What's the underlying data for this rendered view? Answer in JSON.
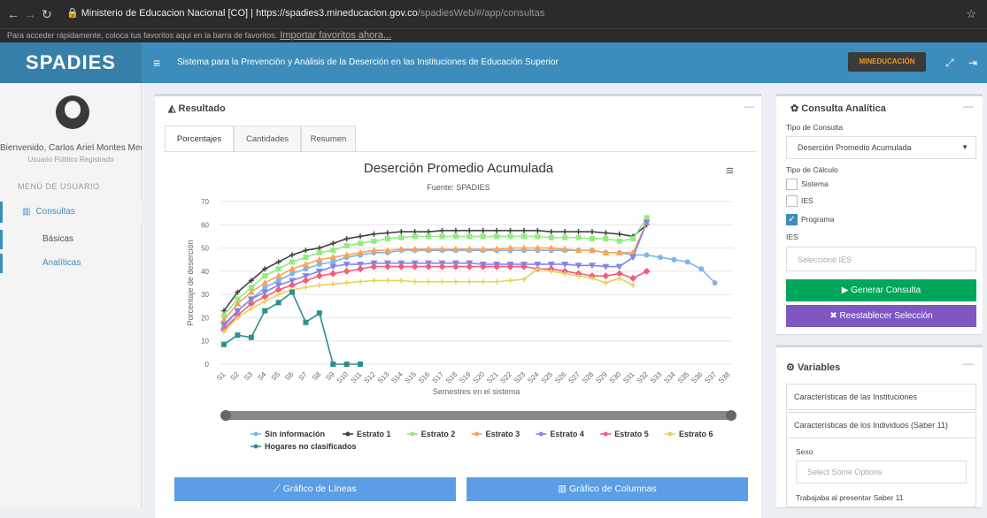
{
  "browser": {
    "url_title": "Ministerio de Educacion Nacional [CO]",
    "url_host": "https://spadies3.mineducacion.gov.co",
    "url_path": "/spadiesWeb/#/app/consultas",
    "bookmarks_text": "Para acceder rápidamente, coloca tus favoritos aquí en la barra de favoritos.",
    "bookmarks_link": "Importar favoritos ahora..."
  },
  "header": {
    "logo": "SPADIES",
    "title": "Sistema para la Prevención y Análisis de la Deserción en las Instituciones de Educación Superior",
    "brand_button": "MINEDUCACIÓN"
  },
  "sidebar": {
    "welcome": "Bienvenido, Carlos Ariel Montes Medina",
    "role": "Usuario Público Registrado",
    "menu_header": "MENÚ DE USUARIO",
    "consultas": "Consultas",
    "basicas": "Básicas",
    "analiticas": "Analíticas"
  },
  "result": {
    "title": "Resultado",
    "tabs": [
      "Porcentajes",
      "Cantidades",
      "Resumen"
    ],
    "btn_lines": "Gráfico de Líneas",
    "btn_columns": "Gráfico de Columnas"
  },
  "consulta": {
    "title": "Consulta Analítica",
    "tipo_label": "Tipo de Consulta",
    "tipo_value": "Deserción Promedio Acumulada",
    "calc_label": "Tipo de Cálculo",
    "opt_sistema": "Sistema",
    "opt_ies": "IES",
    "opt_programa": "Programa",
    "ies_label": "IES",
    "ies_placeholder": "Seleccione IES",
    "btn_generar": "Generar Consulta",
    "btn_reset": "Reestablecer Selección"
  },
  "variables": {
    "title": "Variables",
    "panel1": "Características de las Instituciones",
    "panel2": "Características de los Individuos (Saber 11)",
    "sexo_label": "Sexo",
    "sexo_placeholder": "Select Some Options",
    "trabajaba_label": "Trabajaba al presentar Saber 11"
  },
  "chart_data": {
    "type": "line",
    "title": "Deserción Promedio Acumulada",
    "subtitle": "Fuente: SPADIES",
    "xlabel": "Semestres en el sistema",
    "ylabel": "Porcentaje de deserción",
    "ylim": [
      0,
      70
    ],
    "yticks": [
      0,
      10,
      20,
      30,
      40,
      50,
      60,
      70
    ],
    "categories": [
      "S1",
      "S2",
      "S3",
      "S4",
      "S5",
      "S6",
      "S7",
      "S8",
      "S9",
      "S10",
      "S11",
      "S12",
      "S13",
      "S14",
      "S15",
      "S16",
      "S17",
      "S18",
      "S19",
      "S20",
      "S21",
      "S22",
      "S23",
      "S24",
      "S25",
      "S26",
      "S27",
      "S28",
      "S29",
      "S30",
      "S31",
      "S32",
      "S33",
      "S34",
      "S35",
      "S36",
      "S37",
      "S38"
    ],
    "legend_position": "bottom",
    "series": [
      {
        "name": "Sin información",
        "color": "#7cb5ec",
        "marker": "circle",
        "values": [
          16,
          23,
          28,
          33,
          36,
          39,
          41,
          43,
          44,
          46,
          47,
          48,
          48,
          49,
          49,
          49,
          49,
          49,
          49,
          49,
          49,
          49,
          49,
          49,
          49,
          49,
          49,
          49,
          48,
          48,
          47,
          47,
          46,
          45,
          44,
          41,
          35
        ]
      },
      {
        "name": "Estrato 1",
        "color": "#434348",
        "marker": "cross",
        "values": [
          23,
          31,
          36,
          41,
          44,
          47,
          49,
          50,
          52,
          54,
          55,
          56,
          56.5,
          57,
          57,
          57,
          57.5,
          57.5,
          57.5,
          57.5,
          57.5,
          57.5,
          57.5,
          57.5,
          57,
          57,
          57,
          57,
          56.5,
          56,
          55,
          60
        ]
      },
      {
        "name": "Estrato 2",
        "color": "#90ed7d",
        "marker": "square",
        "values": [
          21,
          28,
          33,
          38,
          41,
          44,
          46,
          48,
          49,
          51,
          52,
          53,
          54,
          54.5,
          55,
          55,
          55,
          55,
          55,
          55,
          55,
          55,
          55,
          55,
          54.5,
          54.5,
          54.5,
          54,
          54,
          53,
          54,
          63
        ]
      },
      {
        "name": "Estrato 3",
        "color": "#f7a35c",
        "marker": "triangle",
        "values": [
          19,
          26,
          31,
          35,
          38,
          41,
          43,
          45,
          46,
          47,
          48,
          49,
          49,
          49.5,
          49.5,
          49.5,
          49.5,
          49.5,
          49.5,
          49.5,
          49.5,
          50,
          50,
          50,
          50,
          49.5,
          49,
          49,
          48,
          48,
          48,
          61
        ]
      },
      {
        "name": "Estrato 4",
        "color": "#8085e9",
        "marker": "triangle-down",
        "values": [
          17,
          23,
          28,
          31,
          34,
          36,
          38,
          40,
          42,
          43,
          43,
          43.5,
          43.5,
          43.5,
          43.5,
          43.5,
          43.5,
          43.5,
          43.5,
          43,
          43,
          43,
          43,
          43,
          43,
          43,
          42.5,
          42.5,
          42,
          42,
          46,
          61
        ]
      },
      {
        "name": "Estrato 5",
        "color": "#f15c80",
        "marker": "diamond",
        "values": [
          15,
          21,
          26,
          29,
          32,
          34,
          36,
          38,
          39,
          40,
          41,
          42,
          42,
          42,
          42,
          42,
          42,
          42,
          42,
          42,
          42,
          42,
          42,
          41,
          41,
          40,
          39,
          38,
          38,
          39,
          37,
          40
        ]
      },
      {
        "name": "Estrato 6",
        "color": "#e4d354",
        "marker": "cross",
        "values": [
          14,
          20,
          24,
          27,
          30,
          32,
          33,
          34,
          34.5,
          35,
          35.5,
          36,
          36,
          36,
          35.5,
          35.5,
          35.5,
          35.5,
          35.5,
          35.5,
          35.5,
          36,
          36.5,
          41,
          40,
          39,
          38,
          37,
          35,
          37,
          34
        ]
      },
      {
        "name": "Hogares no clasificados",
        "color": "#2b908f",
        "marker": "square",
        "values": [
          8.5,
          12.5,
          11.5,
          23,
          26.5,
          31,
          18,
          22,
          0,
          0,
          0
        ]
      }
    ]
  },
  "colors": {
    "topbar": "#3c8dbc",
    "logo_bg": "#367fa9",
    "btn_green": "#00a65a",
    "btn_purple": "#7e57c2",
    "btn_blue": "#5b9ee6"
  }
}
